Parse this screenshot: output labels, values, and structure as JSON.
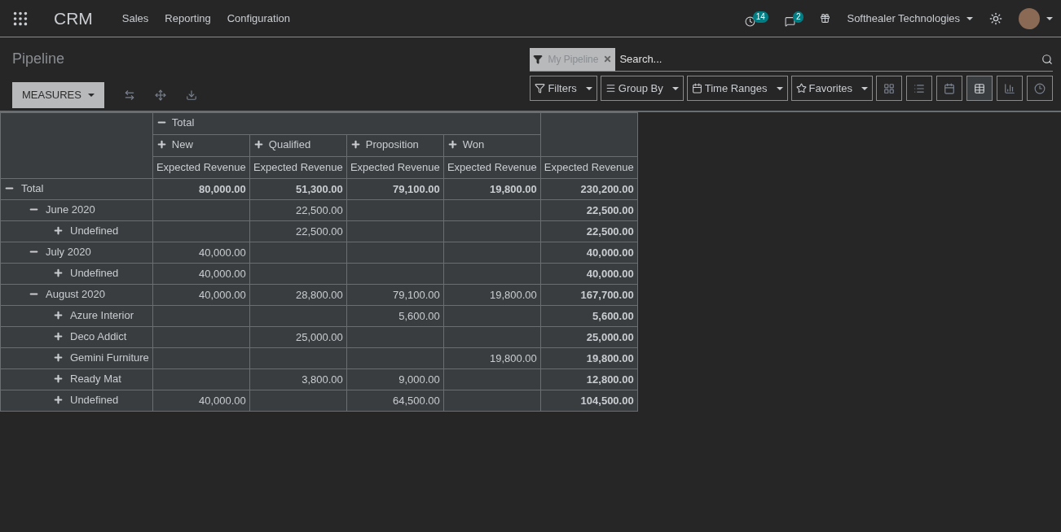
{
  "navbar": {
    "app_name": "CRM",
    "menu": [
      "Sales",
      "Reporting",
      "Configuration"
    ],
    "activity_count": "14",
    "message_count": "2",
    "company": "Softhealer Technologies"
  },
  "control_panel": {
    "title": "Pipeline",
    "measures_button": "MEASURES",
    "search": {
      "facet": "My Pipeline",
      "placeholder": "Search..."
    },
    "search_buttons": [
      "Filters",
      "Group By",
      "Time Ranges",
      "Favorites"
    ],
    "views": [
      {
        "kind": "kanban",
        "selected": false
      },
      {
        "kind": "list",
        "selected": false
      },
      {
        "kind": "calendar",
        "selected": false
      },
      {
        "kind": "pivot",
        "selected": true
      },
      {
        "kind": "graph",
        "selected": false
      },
      {
        "kind": "activity",
        "selected": false
      }
    ]
  },
  "pivot": {
    "column_group": {
      "label": "Total",
      "expanded": true
    },
    "columns": [
      {
        "label": "New",
        "expanded": false
      },
      {
        "label": "Qualified",
        "expanded": false
      },
      {
        "label": "Proposition",
        "expanded": false
      },
      {
        "label": "Won",
        "expanded": false
      }
    ],
    "measure": [
      "Expected Revenue",
      "Expected Revenue",
      "Expected Revenue",
      "Expected Revenue",
      "Expected Revenue"
    ],
    "rows": [
      {
        "label": "Total",
        "expanded": true,
        "cells": [
          {
            "kind": "value",
            "text": "80,000.00"
          },
          {
            "kind": "value",
            "text": "51,300.00"
          },
          {
            "kind": "value",
            "text": "79,100.00"
          },
          {
            "kind": "value",
            "text": "19,800.00"
          }
        ],
        "total": "230,200.00",
        "children": [
          {
            "label": "June 2020",
            "expanded": true,
            "cells": [
              {
                "kind": "blank"
              },
              {
                "kind": "value",
                "text": "22,500.00"
              },
              {
                "kind": "blank"
              },
              {
                "kind": "blank"
              }
            ],
            "total": "22,500.00",
            "children": [
              {
                "label": "Undefined",
                "expanded": false,
                "cells": [
                  {
                    "kind": "blank"
                  },
                  {
                    "kind": "value",
                    "text": "22,500.00"
                  },
                  {
                    "kind": "blank"
                  },
                  {
                    "kind": "blank"
                  }
                ],
                "total": "22,500.00"
              }
            ]
          },
          {
            "label": "July 2020",
            "expanded": true,
            "cells": [
              {
                "kind": "value",
                "text": "40,000.00"
              },
              {
                "kind": "blank"
              },
              {
                "kind": "blank"
              },
              {
                "kind": "blank"
              }
            ],
            "total": "40,000.00",
            "children": [
              {
                "label": "Undefined",
                "expanded": false,
                "cells": [
                  {
                    "kind": "value",
                    "text": "40,000.00"
                  },
                  {
                    "kind": "blank"
                  },
                  {
                    "kind": "blank"
                  },
                  {
                    "kind": "blank"
                  }
                ],
                "total": "40,000.00"
              }
            ]
          },
          {
            "label": "August 2020",
            "expanded": true,
            "cells": [
              {
                "kind": "value",
                "text": "40,000.00"
              },
              {
                "kind": "value",
                "text": "28,800.00"
              },
              {
                "kind": "value",
                "text": "79,100.00"
              },
              {
                "kind": "value",
                "text": "19,800.00"
              }
            ],
            "total": "167,700.00",
            "children": [
              {
                "label": "Azure Interior",
                "expanded": false,
                "cells": [
                  {
                    "kind": "blank"
                  },
                  {
                    "kind": "blank"
                  },
                  {
                    "kind": "value",
                    "text": "5,600.00"
                  },
                  {
                    "kind": "blank"
                  }
                ],
                "total": "5,600.00"
              },
              {
                "label": "Deco Addict",
                "expanded": false,
                "cells": [
                  {
                    "kind": "blank"
                  },
                  {
                    "kind": "value",
                    "text": "25,000.00"
                  },
                  {
                    "kind": "blank"
                  },
                  {
                    "kind": "blank"
                  }
                ],
                "total": "25,000.00"
              },
              {
                "label": "Gemini Furniture",
                "expanded": false,
                "cells": [
                  {
                    "kind": "blank"
                  },
                  {
                    "kind": "blank"
                  },
                  {
                    "kind": "blank"
                  },
                  {
                    "kind": "value",
                    "text": "19,800.00"
                  }
                ],
                "total": "19,800.00"
              },
              {
                "label": "Ready Mat",
                "expanded": false,
                "cells": [
                  {
                    "kind": "blank"
                  },
                  {
                    "kind": "value",
                    "text": "3,800.00"
                  },
                  {
                    "kind": "value",
                    "text": "9,000.00"
                  },
                  {
                    "kind": "blank"
                  }
                ],
                "total": "12,800.00"
              },
              {
                "label": "Undefined",
                "expanded": false,
                "cells": [
                  {
                    "kind": "value",
                    "text": "40,000.00"
                  },
                  {
                    "kind": "blank"
                  },
                  {
                    "kind": "value",
                    "text": "64,500.00"
                  },
                  {
                    "kind": "blank"
                  }
                ],
                "total": "104,500.00"
              }
            ]
          }
        ]
      }
    ]
  }
}
